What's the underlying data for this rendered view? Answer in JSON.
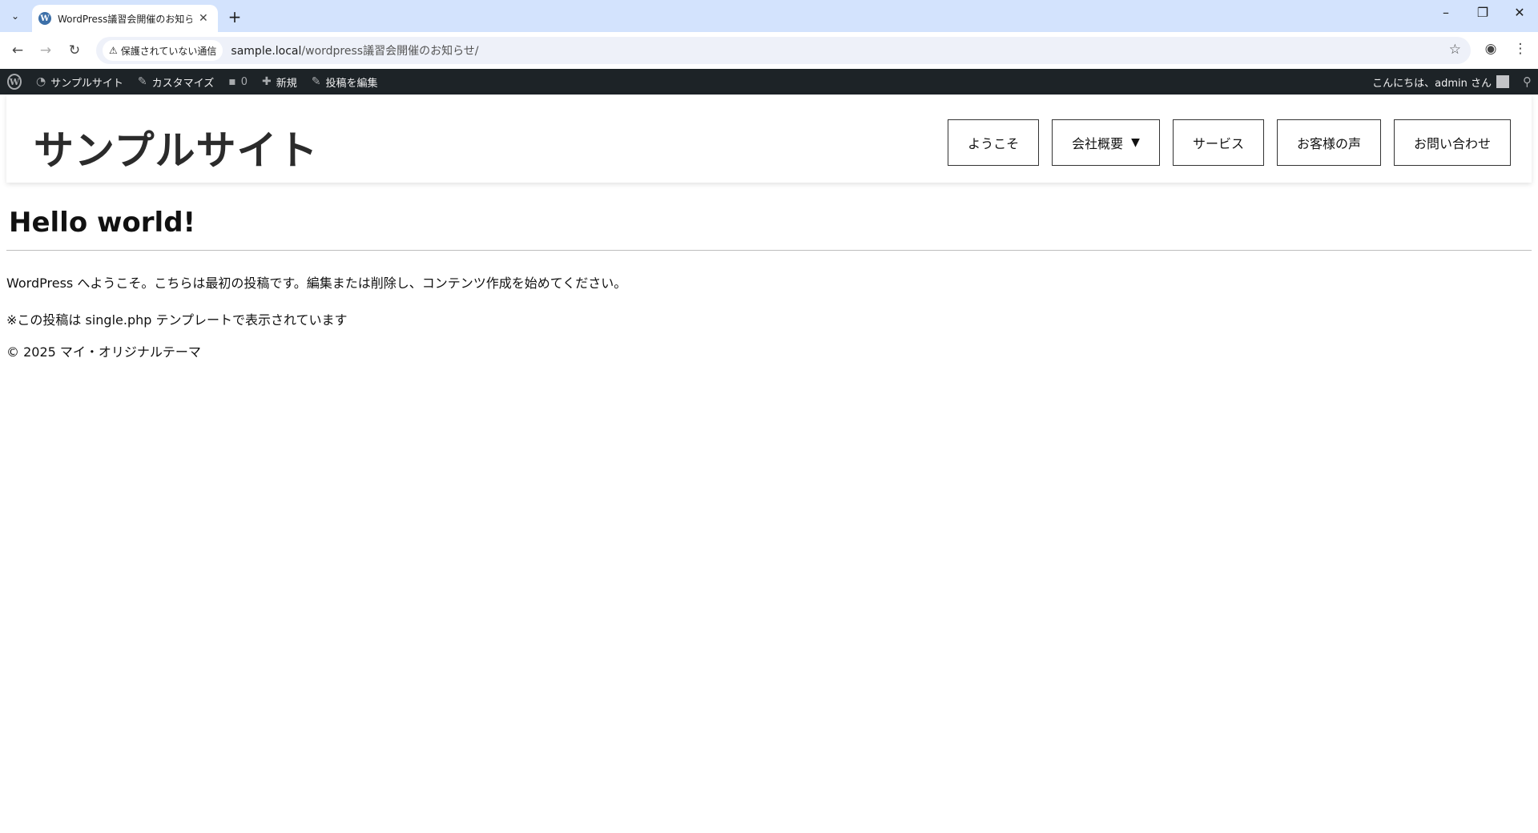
{
  "browser": {
    "tab_title": "WordPress議習会開催のお知らせ",
    "url_host": "sample.local",
    "url_path": "/wordpress議習会開催のお知らせ/",
    "security_label": "保護されていない通信"
  },
  "adminbar": {
    "site_name": "サンプルサイト",
    "customize": "カスタマイズ",
    "comments_count": "0",
    "new": "新規",
    "edit_post": "投稿を編集",
    "greeting": "こんにちは、admin さん"
  },
  "site": {
    "title": "サンプルサイト",
    "nav": [
      {
        "label": "ようこそ"
      },
      {
        "label": "会社概要"
      },
      {
        "label": "サービス"
      },
      {
        "label": "お客様の声"
      },
      {
        "label": "お問い合わせ"
      }
    ],
    "nav_caret": "▼"
  },
  "post": {
    "title": "Hello world!",
    "body": "WordPress へようこそ。こちらは最初の投稿です。編集または削除し、コンテンツ作成を始めてください。",
    "note": "※この投稿は single.php テンプレートで表示されています"
  },
  "footer": {
    "copyright": "© 2025 マイ・オリジナルテーマ"
  }
}
